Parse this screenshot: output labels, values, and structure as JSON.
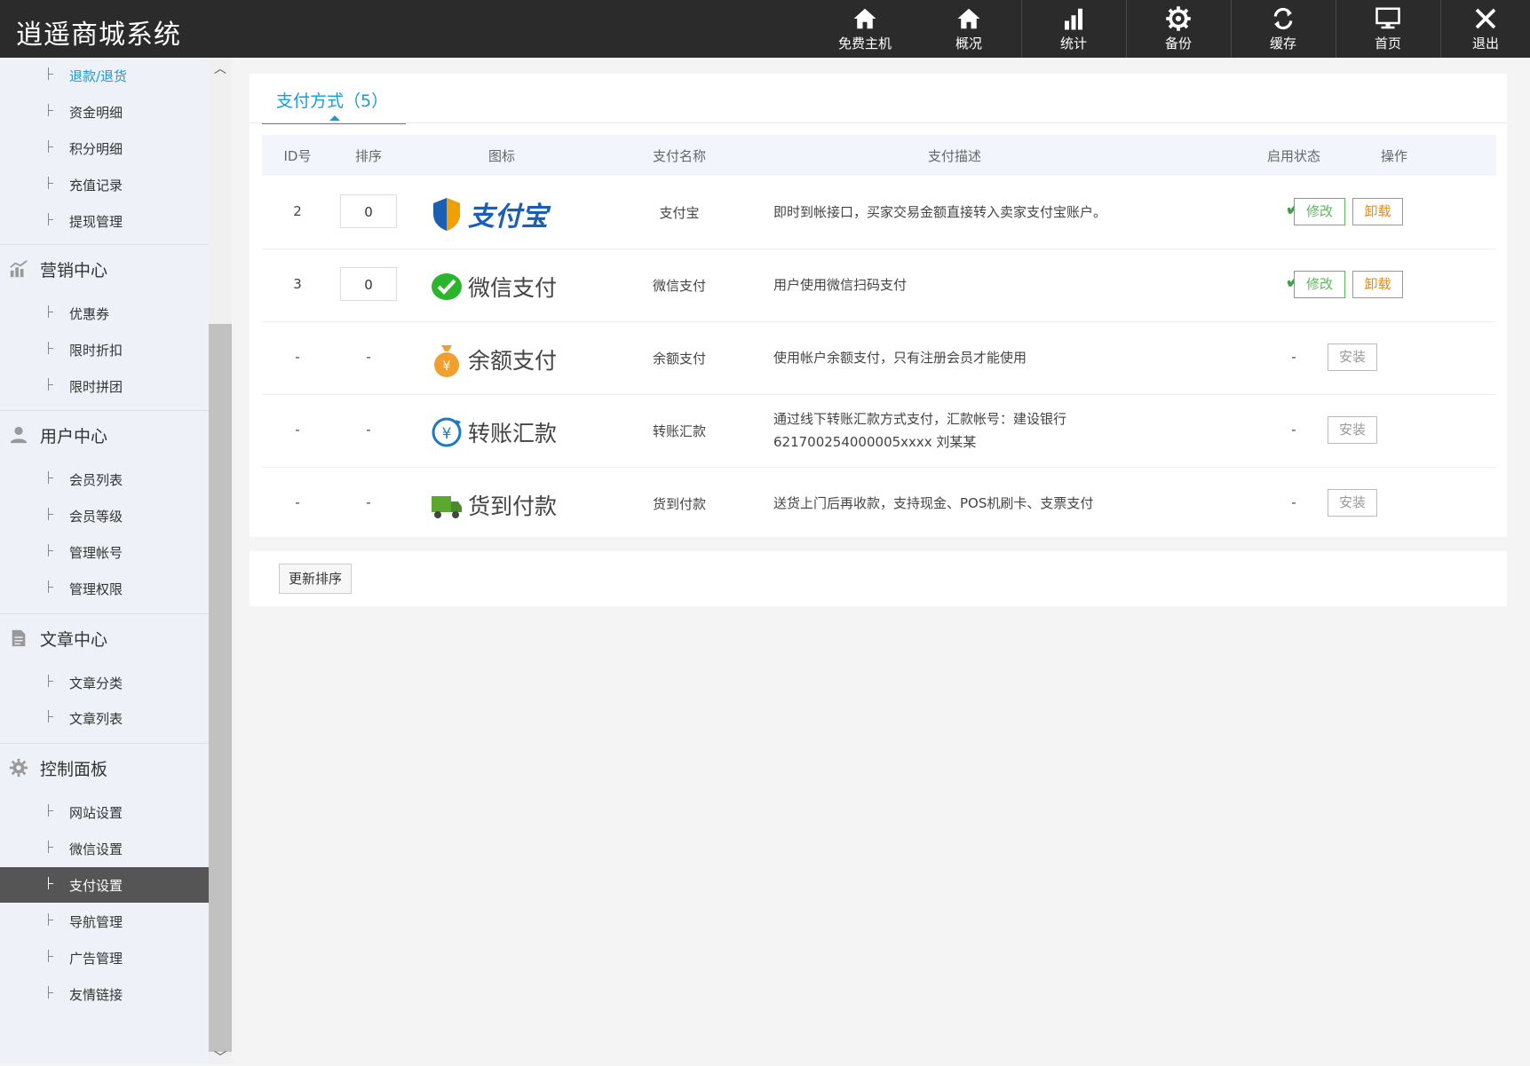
{
  "app_title": "逍遥商城系统",
  "top_nav": [
    {
      "label": "免费主机",
      "icon": "home-icon"
    },
    {
      "label": "概况",
      "icon": "home-icon"
    },
    {
      "label": "统计",
      "icon": "bar-chart-icon"
    },
    {
      "label": "备份",
      "icon": "gear-icon"
    },
    {
      "label": "缓存",
      "icon": "refresh-icon"
    },
    {
      "label": "首页",
      "icon": "monitor-icon"
    },
    {
      "label": "退出",
      "icon": "close-icon"
    }
  ],
  "sidebar": {
    "order_items": [
      "退款/退货",
      "资金明细",
      "积分明细",
      "充值记录",
      "提现管理"
    ],
    "marketing": {
      "title": "营销中心",
      "items": [
        "优惠券",
        "限时折扣",
        "限时拼团"
      ]
    },
    "users": {
      "title": "用户中心",
      "items": [
        "会员列表",
        "会员等级",
        "管理帐号",
        "管理权限"
      ]
    },
    "articles": {
      "title": "文章中心",
      "items": [
        "文章分类",
        "文章列表"
      ]
    },
    "control": {
      "title": "控制面板",
      "items": [
        "网站设置",
        "微信设置",
        "支付设置",
        "导航管理",
        "广告管理",
        "友情链接"
      ]
    },
    "active_item": "支付设置"
  },
  "tab": {
    "label": "支付方式（5）"
  },
  "table": {
    "headers": [
      "ID号",
      "排序",
      "图标",
      "支付名称",
      "支付描述",
      "启用状态",
      "操作"
    ],
    "rows": [
      {
        "id": "2",
        "sort": "0",
        "logo_text": "支付宝",
        "name": "支付宝",
        "desc": "即时到帐接口，买家交易金额直接转入卖家支付宝账户。",
        "status": "✔",
        "actions": [
          "修改",
          "卸载"
        ]
      },
      {
        "id": "3",
        "sort": "0",
        "logo_text": "微信支付",
        "name": "微信支付",
        "desc": "用户使用微信扫码支付",
        "status": "✔",
        "actions": [
          "修改",
          "卸载"
        ]
      },
      {
        "id": "-",
        "sort": "-",
        "logo_text": "余额支付",
        "name": "余额支付",
        "desc": "使用帐户余额支付，只有注册会员才能使用",
        "status": "-",
        "actions": [
          "安装"
        ]
      },
      {
        "id": "-",
        "sort": "-",
        "logo_text": "转账汇款",
        "name": "转账汇款",
        "desc": "通过线下转账汇款方式支付，汇款帐号：建设银行621700254000005xxxx 刘某某",
        "status": "-",
        "actions": [
          "安装"
        ]
      },
      {
        "id": "-",
        "sort": "-",
        "logo_text": "货到付款",
        "name": "货到付款",
        "desc": "送货上门后再收款，支持现金、POS机刷卡、支票支付",
        "status": "-",
        "actions": [
          "安装"
        ]
      }
    ]
  },
  "update_sort_label": "更新排序",
  "colors": {
    "accent": "#1a9ad6",
    "topbar": "#2b2b2b",
    "edit": "#5cb85c",
    "uninstall": "#e08b1a"
  }
}
